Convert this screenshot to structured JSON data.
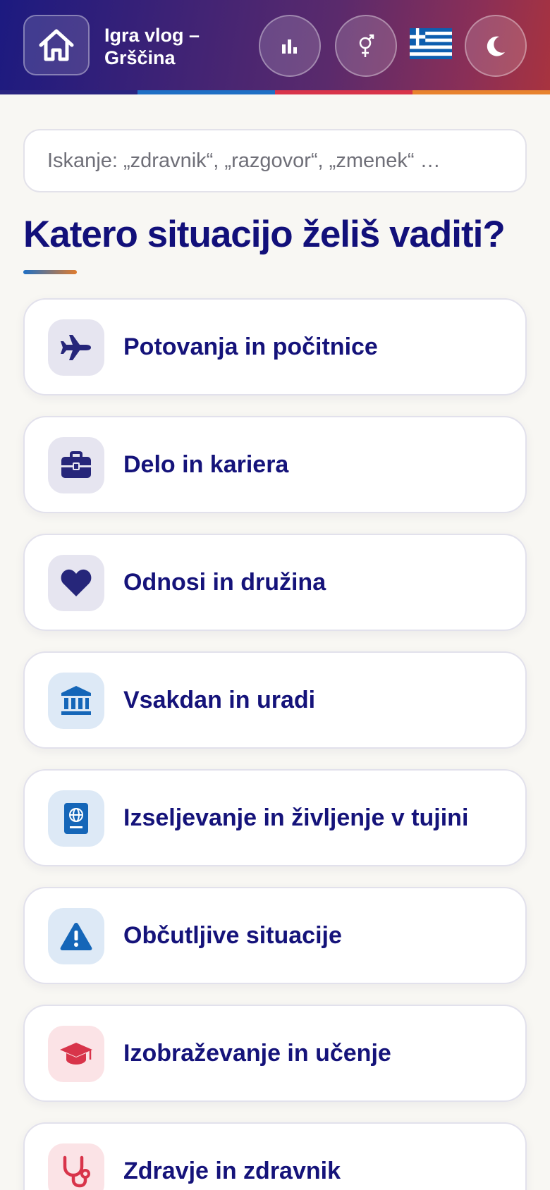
{
  "header": {
    "title": "Igra vlog – Grščina",
    "home_icon": "home-icon",
    "stats_icon": "bar-chart-icon",
    "gender_icon": "gender-icon",
    "flag_icon": "greece-flag-icon",
    "theme_icon": "moon-icon",
    "stripe_colors": [
      "#1c1a80",
      "#1f6fc4",
      "#d8344a",
      "#e8832e"
    ]
  },
  "search": {
    "placeholder": "Iskanje: „zdravnik“, „razgovor“, „zmenek“ …"
  },
  "main": {
    "heading": "Katero situacijo želiš vaditi?",
    "categories": [
      {
        "label": "Potovanja in počitnice",
        "icon": "airplane-icon",
        "icon_bg": "#e6e5f0",
        "icon_color": "#26267a"
      },
      {
        "label": "Delo in kariera",
        "icon": "briefcase-icon",
        "icon_bg": "#e6e5f0",
        "icon_color": "#26267a"
      },
      {
        "label": "Odnosi in družina",
        "icon": "heart-icon",
        "icon_bg": "#e6e5f0",
        "icon_color": "#26267a"
      },
      {
        "label": "Vsakdan in uradi",
        "icon": "government-building-icon",
        "icon_bg": "#dde9f6",
        "icon_color": "#1566b8"
      },
      {
        "label": "Izseljevanje in življenje v tujini",
        "icon": "passport-icon",
        "icon_bg": "#dde9f6",
        "icon_color": "#1566b8"
      },
      {
        "label": "Občutljive situacije",
        "icon": "warning-icon",
        "icon_bg": "#dde9f6",
        "icon_color": "#1566b8"
      },
      {
        "label": "Izobraževanje in učenje",
        "icon": "graduation-cap-icon",
        "icon_bg": "#fbe3e6",
        "icon_color": "#d8344a"
      },
      {
        "label": "Zdravje in zdravnik",
        "icon": "stethoscope-icon",
        "icon_bg": "#fbe3e6",
        "icon_color": "#d8344a"
      }
    ]
  }
}
